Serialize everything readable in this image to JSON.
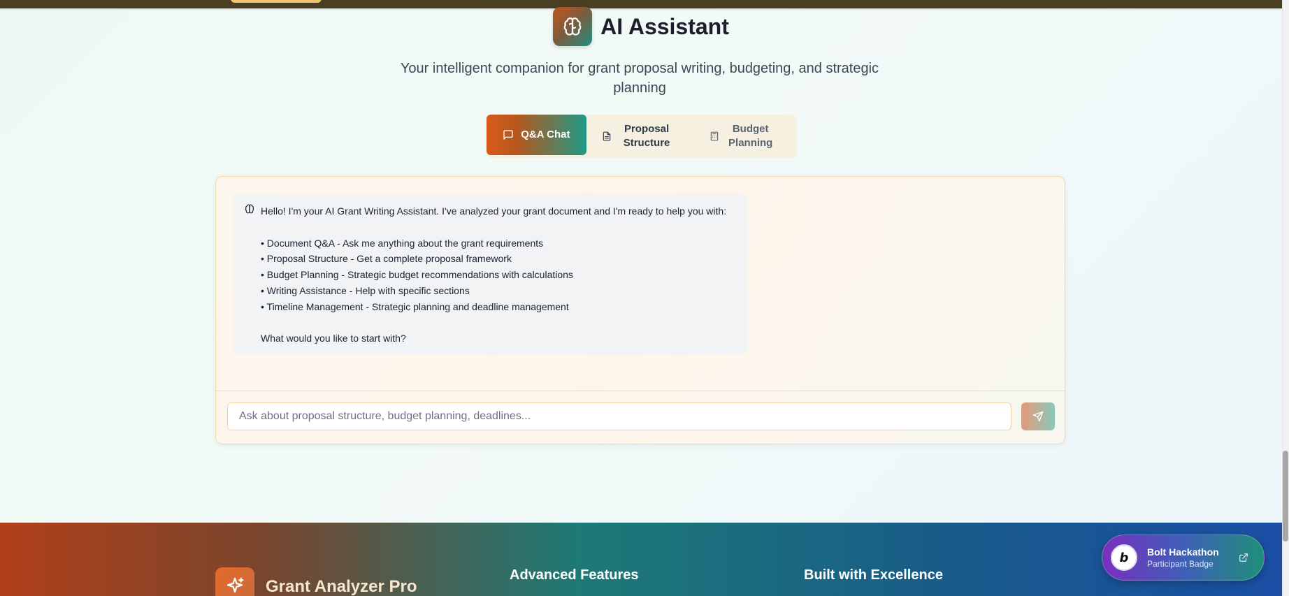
{
  "header": {
    "title": "AI Assistant",
    "subtitle": "Your intelligent companion for grant proposal writing, budgeting, and strategic planning"
  },
  "tabs": [
    {
      "label": "Q&A Chat",
      "icon": "chat-bubble-icon",
      "active": true
    },
    {
      "label": "Proposal Structure",
      "icon": "document-icon",
      "active": false
    },
    {
      "label": "Budget Planning",
      "icon": "calculator-icon",
      "active": false
    }
  ],
  "chat": {
    "message": {
      "icon": "brain-icon",
      "intro": "Hello! I'm your AI Grant Writing Assistant. I've analyzed your grant document and I'm ready to help you with:",
      "items": [
        "• Document Q&A - Ask me anything about the grant requirements",
        "• Proposal Structure - Get a complete proposal framework",
        "• Budget Planning - Strategic budget recommendations with calculations",
        "• Writing Assistance - Help with specific sections",
        "• Timeline Management - Strategic planning and deadline management"
      ],
      "closing": "What would you like to start with?"
    },
    "input": {
      "placeholder": "Ask about proposal structure, budget planning, deadlines...",
      "value": ""
    },
    "send_icon": "send-icon"
  },
  "footer": {
    "brand": "Grant Analyzer Pro",
    "heading_features": "Advanced Features",
    "heading_built": "Built with Excellence"
  },
  "badge": {
    "title": "Bolt Hackathon",
    "subtitle": "Participant Badge",
    "logo_letter": "b"
  },
  "colors": {
    "accent_orange": "#d85a1a",
    "accent_teal": "#1f9a86",
    "badge_purple": "#7a2fbf"
  }
}
